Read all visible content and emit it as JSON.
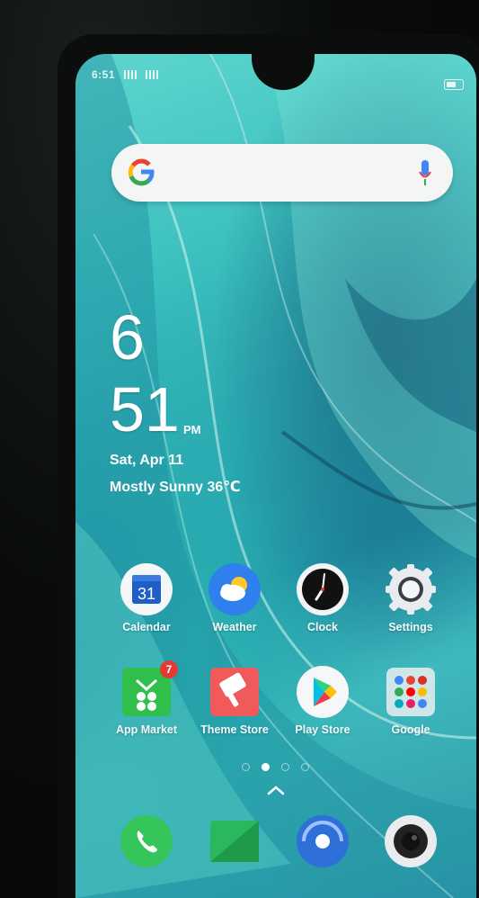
{
  "status_bar": {
    "time": "6:51"
  },
  "search": {},
  "clock_widget": {
    "hour": "6",
    "minute": "51",
    "ampm": "PM",
    "date": "Sat, Apr 11",
    "weather": "Mostly Sunny 36℃"
  },
  "apps": [
    {
      "label": "Calendar",
      "icon": "calendar-icon",
      "icon_text": "31"
    },
    {
      "label": "Weather",
      "icon": "weather-icon"
    },
    {
      "label": "Clock",
      "icon": "clock-icon"
    },
    {
      "label": "Settings",
      "icon": "settings-icon"
    },
    {
      "label": "App Market",
      "icon": "app-market-icon",
      "badge": "7"
    },
    {
      "label": "Theme Store",
      "icon": "theme-store-icon"
    },
    {
      "label": "Play Store",
      "icon": "play-store-icon"
    },
    {
      "label": "Google",
      "icon": "google-folder-icon"
    }
  ],
  "page_indicator": {
    "pages": 4,
    "current": 2
  },
  "dock": [
    {
      "icon": "phone-icon"
    },
    {
      "icon": "messages-icon"
    },
    {
      "icon": "browser-icon"
    },
    {
      "icon": "camera-icon"
    }
  ],
  "colors": {
    "wallpaper_primary": "#3cc0bf",
    "wallpaper_dark": "#1d8aa0",
    "badge": "#e53935"
  }
}
